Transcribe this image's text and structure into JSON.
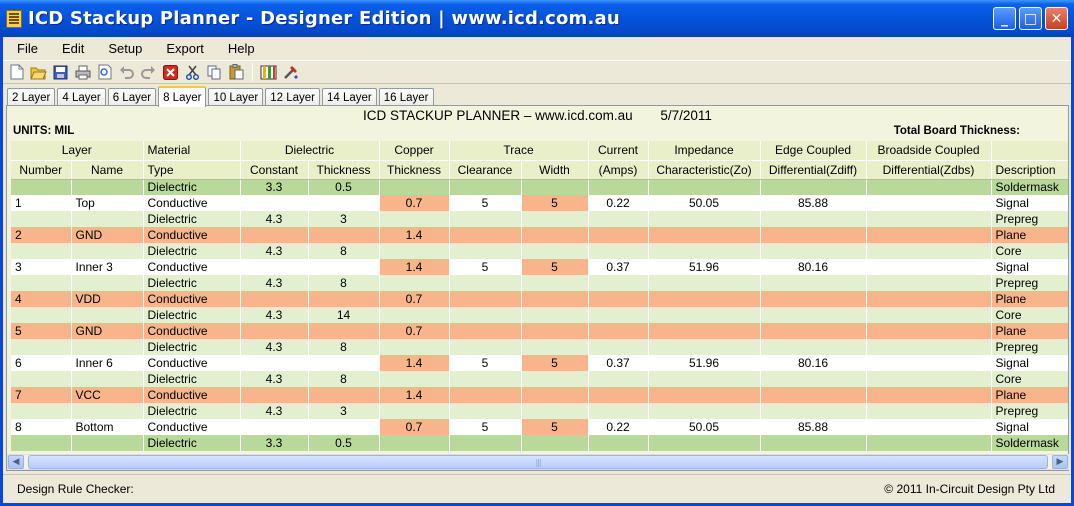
{
  "window": {
    "title": "ICD Stackup Planner - Designer Edition | www.icd.com.au",
    "minimize_label": "_",
    "maximize_label": "□",
    "close_label": "✕"
  },
  "menu": [
    "File",
    "Edit",
    "Setup",
    "Export",
    "Help"
  ],
  "toolbar_icons": [
    "new-icon",
    "open-icon",
    "save-icon",
    "print-icon",
    "print-preview-icon",
    "undo-icon",
    "redo-icon",
    "delete-icon",
    "cut-icon",
    "copy-icon",
    "paste-icon",
    "columns-icon",
    "tools-icon"
  ],
  "tabs": [
    "2 Layer",
    "4 Layer",
    "6 Layer",
    "8 Layer",
    "10 Layer",
    "12 Layer",
    "14 Layer",
    "16 Layer"
  ],
  "active_tab": "8 Layer",
  "report": {
    "title": "ICD STACKUP PLANNER – www.icd.com.au",
    "date": "5/7/2011",
    "units": "UNITS: MIL",
    "total_thickness_label": "Total Board Thickness:"
  },
  "table": {
    "group_headers": [
      "Layer",
      "Material",
      "Dielectric",
      "Copper",
      "Trace",
      "Current",
      "Impedance",
      "Edge Coupled",
      "Broadside Coupled",
      ""
    ],
    "sub_headers": [
      "Number",
      "Name",
      "Type",
      "Constant",
      "Thickness",
      "Thickness",
      "Clearance",
      "Width",
      "(Amps)",
      "Characteristic(Zo)",
      "Differential(Zdiff)",
      "Differential(Zdbs)",
      "Description"
    ],
    "rows": [
      {
        "kind": "mask",
        "number": "",
        "name": "",
        "type": "Dielectric",
        "constant": "3.3",
        "thickness": "0.5",
        "copper": "",
        "clearance": "",
        "width": "",
        "amps": "",
        "zo": "",
        "zdiff": "",
        "zdbs": "",
        "description": "Soldermask"
      },
      {
        "kind": "sig",
        "number": "1",
        "name": "Top",
        "type": "Conductive",
        "constant": "",
        "thickness": "",
        "copper": "0.7",
        "clearance": "5",
        "width": "5",
        "amps": "0.22",
        "zo": "50.05",
        "zdiff": "85.88",
        "zdbs": "",
        "description": "Signal"
      },
      {
        "kind": "diel",
        "number": "",
        "name": "",
        "type": "Dielectric",
        "constant": "4.3",
        "thickness": "3",
        "copper": "",
        "clearance": "",
        "width": "",
        "amps": "",
        "zo": "",
        "zdiff": "",
        "zdbs": "",
        "description": "Prepreg"
      },
      {
        "kind": "plane",
        "number": "2",
        "name": "GND",
        "type": "Conductive",
        "constant": "",
        "thickness": "",
        "copper": "1.4",
        "clearance": "",
        "width": "",
        "amps": "",
        "zo": "",
        "zdiff": "",
        "zdbs": "",
        "description": "Plane"
      },
      {
        "kind": "diel",
        "number": "",
        "name": "",
        "type": "Dielectric",
        "constant": "4.3",
        "thickness": "8",
        "copper": "",
        "clearance": "",
        "width": "",
        "amps": "",
        "zo": "",
        "zdiff": "",
        "zdbs": "",
        "description": "Core"
      },
      {
        "kind": "sig",
        "number": "3",
        "name": "Inner 3",
        "type": "Conductive",
        "constant": "",
        "thickness": "",
        "copper": "1.4",
        "clearance": "5",
        "width": "5",
        "amps": "0.37",
        "zo": "51.96",
        "zdiff": "80.16",
        "zdbs": "",
        "description": "Signal"
      },
      {
        "kind": "diel",
        "number": "",
        "name": "",
        "type": "Dielectric",
        "constant": "4.3",
        "thickness": "8",
        "copper": "",
        "clearance": "",
        "width": "",
        "amps": "",
        "zo": "",
        "zdiff": "",
        "zdbs": "",
        "description": "Prepreg"
      },
      {
        "kind": "plane",
        "number": "4",
        "name": "VDD",
        "type": "Conductive",
        "constant": "",
        "thickness": "",
        "copper": "0.7",
        "clearance": "",
        "width": "",
        "amps": "",
        "zo": "",
        "zdiff": "",
        "zdbs": "",
        "description": "Plane"
      },
      {
        "kind": "diel",
        "number": "",
        "name": "",
        "type": "Dielectric",
        "constant": "4.3",
        "thickness": "14",
        "copper": "",
        "clearance": "",
        "width": "",
        "amps": "",
        "zo": "",
        "zdiff": "",
        "zdbs": "",
        "description": "Core"
      },
      {
        "kind": "plane",
        "number": "5",
        "name": "GND",
        "type": "Conductive",
        "constant": "",
        "thickness": "",
        "copper": "0.7",
        "clearance": "",
        "width": "",
        "amps": "",
        "zo": "",
        "zdiff": "",
        "zdbs": "",
        "description": "Plane"
      },
      {
        "kind": "diel",
        "number": "",
        "name": "",
        "type": "Dielectric",
        "constant": "4.3",
        "thickness": "8",
        "copper": "",
        "clearance": "",
        "width": "",
        "amps": "",
        "zo": "",
        "zdiff": "",
        "zdbs": "",
        "description": "Prepreg"
      },
      {
        "kind": "sig",
        "number": "6",
        "name": "Inner 6",
        "type": "Conductive",
        "constant": "",
        "thickness": "",
        "copper": "1.4",
        "clearance": "5",
        "width": "5",
        "amps": "0.37",
        "zo": "51.96",
        "zdiff": "80.16",
        "zdbs": "",
        "description": "Signal"
      },
      {
        "kind": "diel",
        "number": "",
        "name": "",
        "type": "Dielectric",
        "constant": "4.3",
        "thickness": "8",
        "copper": "",
        "clearance": "",
        "width": "",
        "amps": "",
        "zo": "",
        "zdiff": "",
        "zdbs": "",
        "description": "Core"
      },
      {
        "kind": "plane",
        "number": "7",
        "name": "VCC",
        "type": "Conductive",
        "constant": "",
        "thickness": "",
        "copper": "1.4",
        "clearance": "",
        "width": "",
        "amps": "",
        "zo": "",
        "zdiff": "",
        "zdbs": "",
        "description": "Plane"
      },
      {
        "kind": "diel",
        "number": "",
        "name": "",
        "type": "Dielectric",
        "constant": "4.3",
        "thickness": "3",
        "copper": "",
        "clearance": "",
        "width": "",
        "amps": "",
        "zo": "",
        "zdiff": "",
        "zdbs": "",
        "description": "Prepreg"
      },
      {
        "kind": "sig",
        "number": "8",
        "name": "Bottom",
        "type": "Conductive",
        "constant": "",
        "thickness": "",
        "copper": "0.7",
        "clearance": "5",
        "width": "5",
        "amps": "0.22",
        "zo": "50.05",
        "zdiff": "85.88",
        "zdbs": "",
        "description": "Signal"
      },
      {
        "kind": "mask",
        "number": "",
        "name": "",
        "type": "Dielectric",
        "constant": "3.3",
        "thickness": "0.5",
        "copper": "",
        "clearance": "",
        "width": "",
        "amps": "",
        "zo": "",
        "zdiff": "",
        "zdbs": "",
        "description": "Soldermask"
      }
    ]
  },
  "status": {
    "left": "Design Rule Checker:",
    "right": "© 2011 In-Circuit Design Pty Ltd"
  },
  "colors": {
    "titlebar": "#0553d9",
    "copper_cell": "#f9b48c",
    "dielectric_row": "#e3f0cf",
    "soldermask_row": "#b8d99a"
  }
}
